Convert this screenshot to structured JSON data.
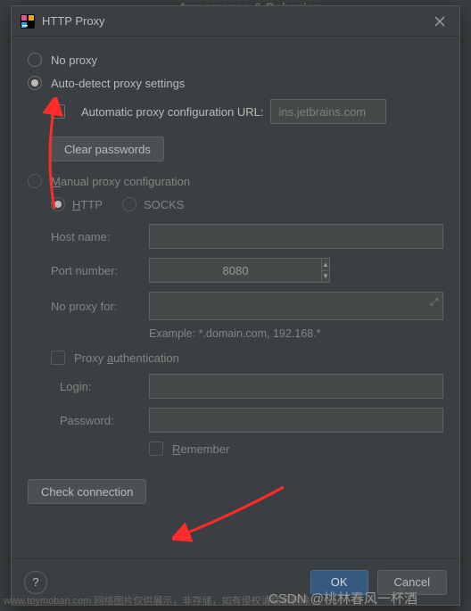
{
  "behind_header": "Appearance & Behavior",
  "titlebar": {
    "title": "HTTP Proxy"
  },
  "options": {
    "no_proxy": "No proxy",
    "auto_detect": "Auto-detect proxy settings",
    "auto_url_label": "Automatic proxy configuration URL:",
    "auto_url_value": "ins.jetbrains.com",
    "clear_passwords": "Clear passwords",
    "manual": "Manual proxy configuration",
    "http": "HTTP",
    "socks": "SOCKS"
  },
  "fields": {
    "host_label": "Host name:",
    "host_value": "",
    "port_label": "Port number:",
    "port_value": "8080",
    "noproxy_label": "No proxy for:",
    "noproxy_value": "",
    "example": "Example: *.domain.com, 192.168.*",
    "auth_label": "Proxy authentication",
    "login_label": "Login:",
    "login_value": "",
    "password_label": "Password:",
    "password_value": "",
    "remember": "Remember"
  },
  "buttons": {
    "check_connection": "Check connection",
    "ok": "OK",
    "cancel": "Cancel"
  },
  "watermark": {
    "left": "www.toymoban.com 网络图片仅供展示，非存储，如有侵权请联系删除",
    "right": "CSDN @桃林春风一杯酒"
  }
}
